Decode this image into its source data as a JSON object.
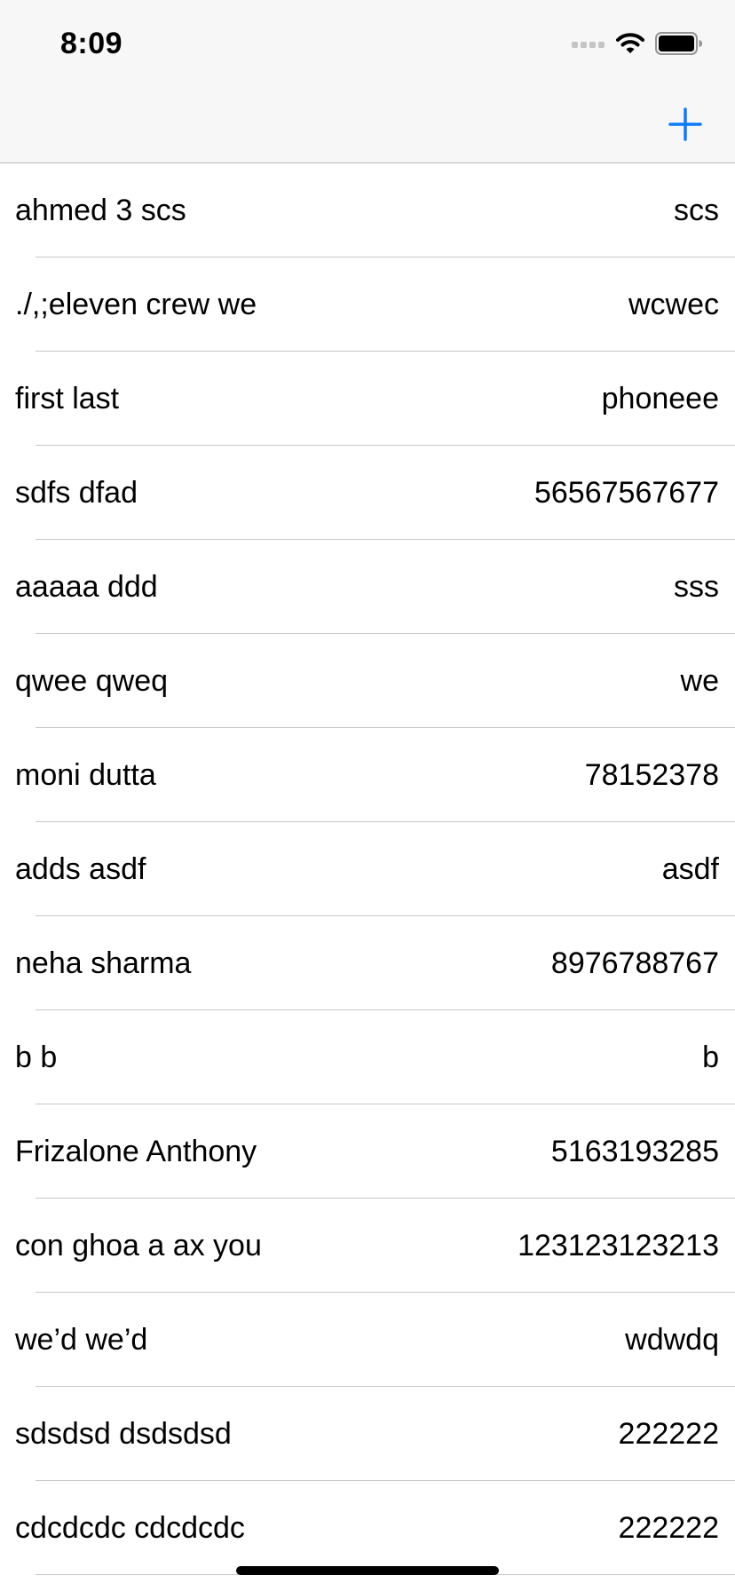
{
  "status_bar": {
    "time": "8:09",
    "icons": [
      "signal-dots-icon",
      "wifi-icon",
      "battery-icon"
    ]
  },
  "nav_bar": {
    "add_icon": "plus-icon",
    "accent_color": "#0a7aff"
  },
  "contacts": [
    {
      "name": "ahmed 3 scs",
      "phone": "scs"
    },
    {
      "name": "./,;eleven crew we",
      "phone": "wcwec"
    },
    {
      "name": "first last",
      "phone": "phoneee"
    },
    {
      "name": "sdfs dfad",
      "phone": "56567567677"
    },
    {
      "name": "aaaaa ddd",
      "phone": "sss"
    },
    {
      "name": "qwee qweq",
      "phone": "we"
    },
    {
      "name": "moni dutta",
      "phone": "78152378"
    },
    {
      "name": "adds asdf",
      "phone": "asdf"
    },
    {
      "name": "neha sharma",
      "phone": "8976788767"
    },
    {
      "name": "b b",
      "phone": "b"
    },
    {
      "name": "Frizalone Anthony",
      "phone": "5163193285"
    },
    {
      "name": "con ghoa a ax you",
      "phone": "123123123213"
    },
    {
      "name": "we’d we’d",
      "phone": "wdwdq"
    },
    {
      "name": "sdsdsd dsdsdsd",
      "phone": "222222"
    },
    {
      "name": "cdcdcdc cdcdcdc",
      "phone": "222222"
    }
  ]
}
